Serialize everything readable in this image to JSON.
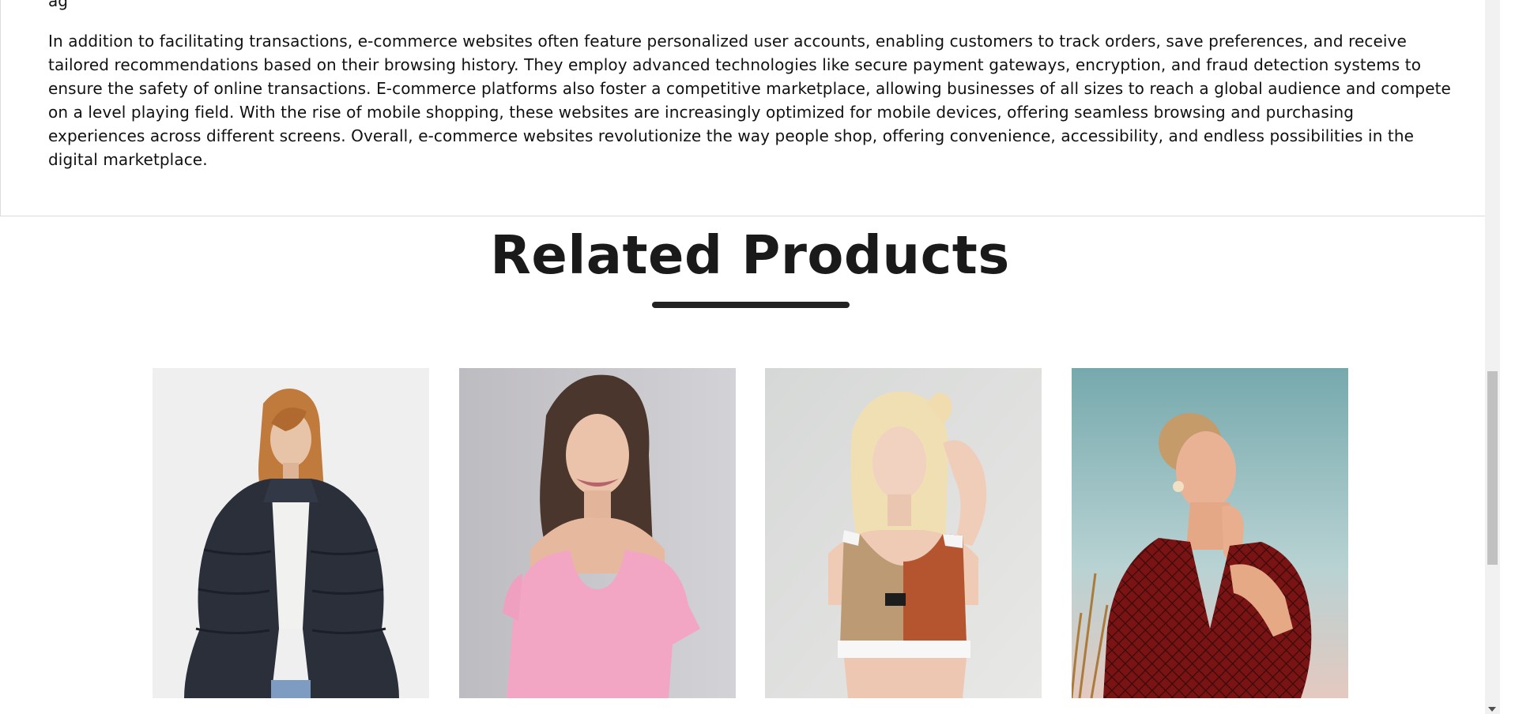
{
  "description": {
    "cutoff_line_start": "ag",
    "paragraph": "In addition to facilitating transactions, e-commerce websites often feature personalized user accounts, enabling customers to track orders, save preferences, and receive tailored recommendations based on their browsing history. They employ advanced technologies like secure payment gateways, encryption, and fraud detection systems to ensure the safety of online transactions. E-commerce platforms also foster a competitive marketplace, allowing businesses of all sizes to reach a global audience and compete on a level playing field. With the rise of mobile shopping, these websites are increasingly optimized for mobile devices, offering seamless browsing and purchasing experiences across different screens. Overall, e-commerce websites revolutionize the way people shop, offering convenience, accessibility, and endless possibilities in the digital marketplace."
  },
  "related": {
    "title": "Related Products"
  },
  "products": [
    {
      "image": "woman-black-fur-jacket-photo"
    },
    {
      "image": "woman-pink-top-photo"
    },
    {
      "image": "woman-sports-crop-top-photo"
    },
    {
      "image": "woman-red-patterned-blouse-photo"
    }
  ],
  "colors": {
    "text": "#111111",
    "heading": "#1a1a1a",
    "underline": "#222222",
    "panel_border": "#dcdcdc"
  }
}
